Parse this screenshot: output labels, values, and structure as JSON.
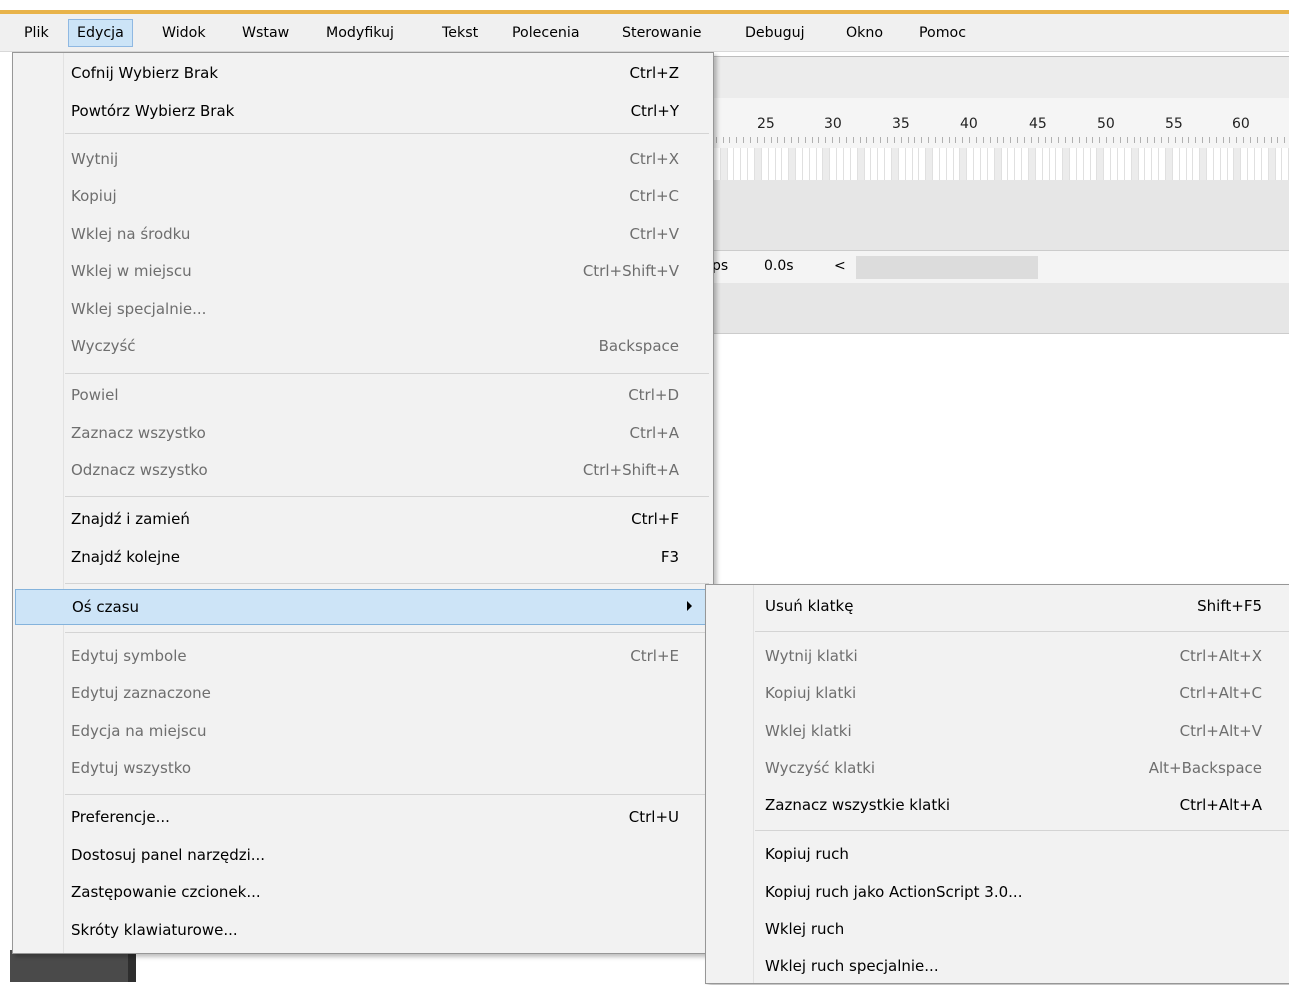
{
  "menubar": {
    "items": [
      "Plik",
      "Edycja",
      "Widok",
      "Wstaw",
      "Modyfikuj",
      "Tekst",
      "Polecenia",
      "Sterowanie",
      "Debuguj",
      "Okno",
      "Pomoc"
    ],
    "open_index": 1
  },
  "timeline": {
    "ruler_numbers": [
      "25",
      "30",
      "35",
      "40",
      "45",
      "50",
      "55",
      "60"
    ],
    "fps_fragment": "ps",
    "time": "0.0s",
    "scroll_left_glyph": "<"
  },
  "edit_menu": {
    "items": [
      {
        "label": "Cofnij Wybierz Brak",
        "shortcut": "Ctrl+Z",
        "enabled": true
      },
      {
        "label": "Powtórz Wybierz Brak",
        "shortcut": "Ctrl+Y",
        "enabled": true
      },
      {
        "label": "Wytnij",
        "shortcut": "Ctrl+X",
        "enabled": false
      },
      {
        "label": "Kopiuj",
        "shortcut": "Ctrl+C",
        "enabled": false
      },
      {
        "label": "Wklej na środku",
        "shortcut": "Ctrl+V",
        "enabled": false
      },
      {
        "label": "Wklej w miejscu",
        "shortcut": "Ctrl+Shift+V",
        "enabled": false
      },
      {
        "label": "Wklej specjalnie...",
        "shortcut": "",
        "enabled": false
      },
      {
        "label": "Wyczyść",
        "shortcut": "Backspace",
        "enabled": false
      },
      {
        "label": "Powiel",
        "shortcut": "Ctrl+D",
        "enabled": false
      },
      {
        "label": "Zaznacz wszystko",
        "shortcut": "Ctrl+A",
        "enabled": false
      },
      {
        "label": "Odznacz wszystko",
        "shortcut": "Ctrl+Shift+A",
        "enabled": false
      },
      {
        "label": "Znajdź i zamień",
        "shortcut": "Ctrl+F",
        "enabled": true
      },
      {
        "label": "Znajdź kolejne",
        "shortcut": "F3",
        "enabled": true
      },
      {
        "label": "Oś czasu",
        "shortcut": "",
        "enabled": true,
        "submenu": true,
        "highlighted": true
      },
      {
        "label": "Edytuj symbole",
        "shortcut": "Ctrl+E",
        "enabled": false
      },
      {
        "label": "Edytuj zaznaczone",
        "shortcut": "",
        "enabled": false
      },
      {
        "label": "Edycja na miejscu",
        "shortcut": "",
        "enabled": false
      },
      {
        "label": "Edytuj wszystko",
        "shortcut": "",
        "enabled": false
      },
      {
        "label": "Preferencje...",
        "shortcut": "Ctrl+U",
        "enabled": true
      },
      {
        "label": "Dostosuj panel narzędzi...",
        "shortcut": "",
        "enabled": true
      },
      {
        "label": "Zastępowanie czcionek...",
        "shortcut": "",
        "enabled": true
      },
      {
        "label": "Skróty klawiaturowe...",
        "shortcut": "",
        "enabled": true
      }
    ]
  },
  "timeline_submenu": {
    "items": [
      {
        "label": "Usuń klatkę",
        "shortcut": "Shift+F5",
        "enabled": true
      },
      {
        "label": "Wytnij klatki",
        "shortcut": "Ctrl+Alt+X",
        "enabled": false
      },
      {
        "label": "Kopiuj klatki",
        "shortcut": "Ctrl+Alt+C",
        "enabled": false
      },
      {
        "label": "Wklej klatki",
        "shortcut": "Ctrl+Alt+V",
        "enabled": false
      },
      {
        "label": "Wyczyść klatki",
        "shortcut": "Alt+Backspace",
        "enabled": false
      },
      {
        "label": "Zaznacz wszystkie klatki",
        "shortcut": "Ctrl+Alt+A",
        "enabled": true
      },
      {
        "label": "Kopiuj ruch",
        "shortcut": "",
        "enabled": true
      },
      {
        "label": "Kopiuj ruch jako ActionScript 3.0...",
        "shortcut": "",
        "enabled": true
      },
      {
        "label": "Wklej ruch",
        "shortcut": "",
        "enabled": true
      },
      {
        "label": "Wklej ruch specjalnie...",
        "shortcut": "",
        "enabled": true
      }
    ]
  }
}
